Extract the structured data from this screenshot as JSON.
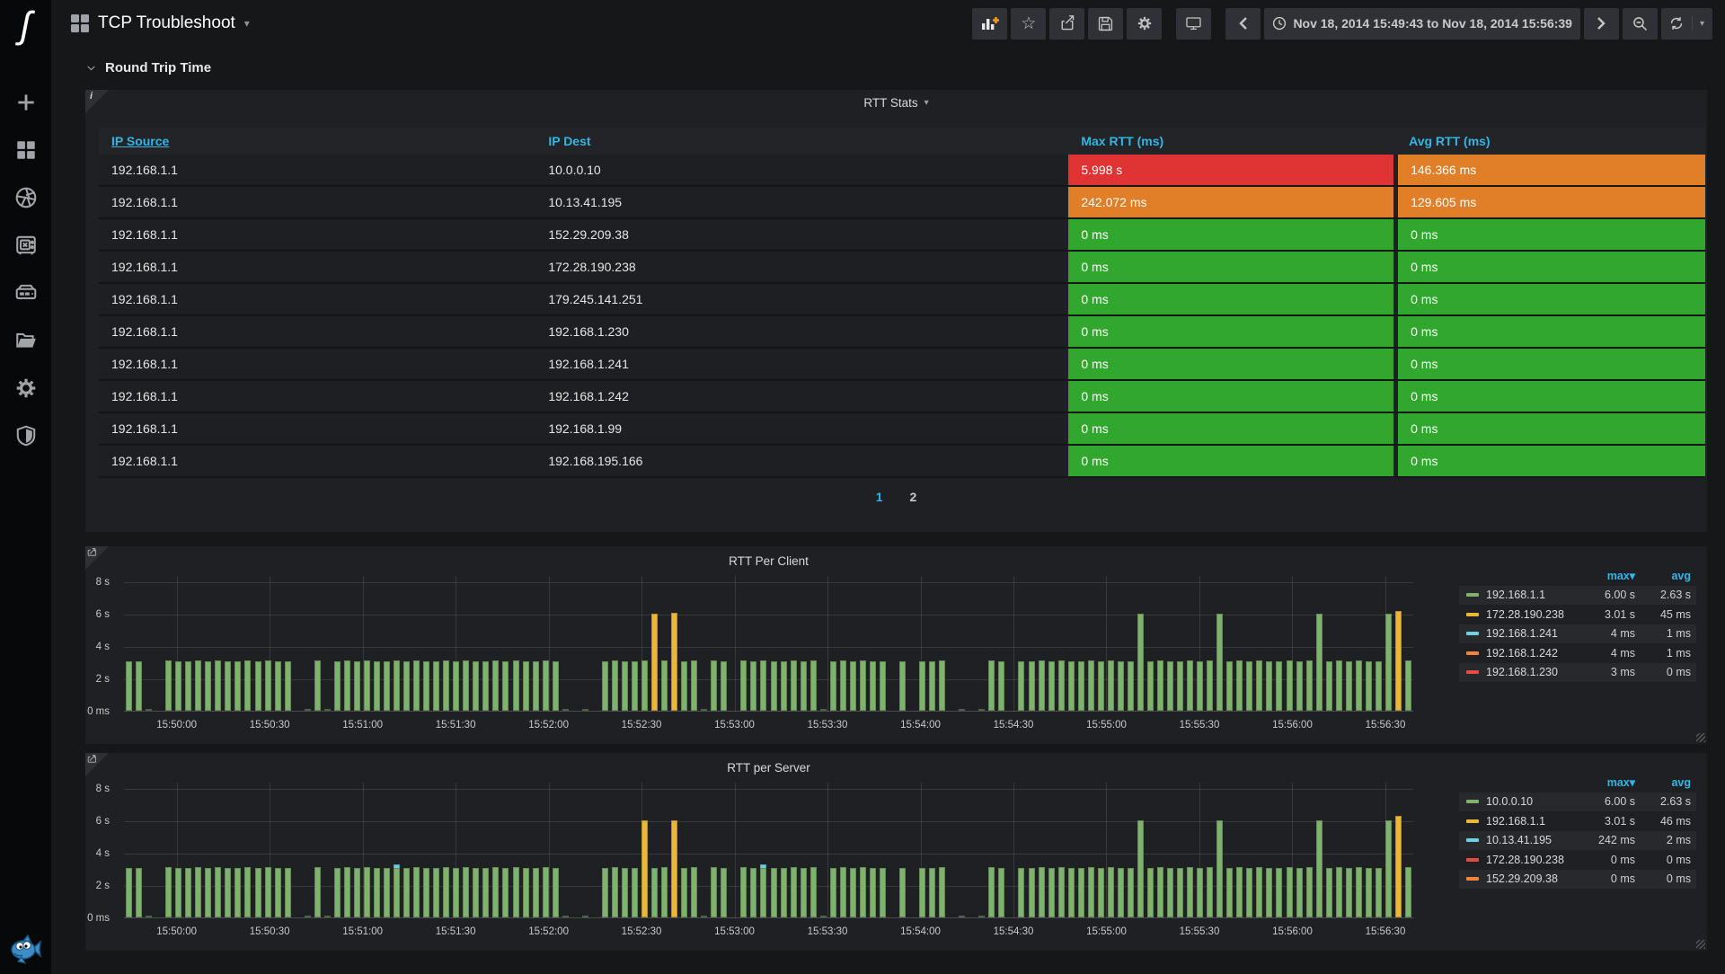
{
  "icons": {
    "caret_down": "▾",
    "star": "☆",
    "info": "i",
    "page_logo": "ʃ"
  },
  "sidebar": {
    "items": [
      {
        "name": "add",
        "icon": "plus-icon"
      },
      {
        "name": "dashboards",
        "icon": "grid-icon"
      },
      {
        "name": "snapshots",
        "icon": "aperture-icon"
      },
      {
        "name": "vault",
        "icon": "safe-icon"
      },
      {
        "name": "datasources",
        "icon": "drive-icon"
      },
      {
        "name": "folders",
        "icon": "folder-icon"
      },
      {
        "name": "settings",
        "icon": "gear-icon"
      },
      {
        "name": "security",
        "icon": "shield-icon"
      }
    ]
  },
  "nav": {
    "title": "TCP Troubleshoot",
    "time_range": "Nov 18, 2014 15:49:43 to Nov 18, 2014 15:56:39"
  },
  "row_header": {
    "title": "Round Trip Time"
  },
  "status_colors": {
    "red": "#e03434",
    "orange": "#e07f28",
    "green": "#31a82d"
  },
  "table_panel": {
    "title": "RTT Stats",
    "columns": [
      {
        "label": "IP Source",
        "sorted": true
      },
      {
        "label": "IP Dest",
        "sorted": false
      },
      {
        "label": "Max RTT (ms)",
        "sorted": false
      },
      {
        "label": "Avg RTT (ms)",
        "sorted": false
      }
    ],
    "rows": [
      {
        "source": "192.168.1.1",
        "dest": "10.0.0.10",
        "max": "5.998 s",
        "max_color": "red",
        "avg": "146.366 ms",
        "avg_color": "orange"
      },
      {
        "source": "192.168.1.1",
        "dest": "10.13.41.195",
        "max": "242.072 ms",
        "max_color": "orange",
        "avg": "129.605 ms",
        "avg_color": "orange"
      },
      {
        "source": "192.168.1.1",
        "dest": "152.29.209.38",
        "max": "0 ms",
        "max_color": "green",
        "avg": "0 ms",
        "avg_color": "green"
      },
      {
        "source": "192.168.1.1",
        "dest": "172.28.190.238",
        "max": "0 ms",
        "max_color": "green",
        "avg": "0 ms",
        "avg_color": "green"
      },
      {
        "source": "192.168.1.1",
        "dest": "179.245.141.251",
        "max": "0 ms",
        "max_color": "green",
        "avg": "0 ms",
        "avg_color": "green"
      },
      {
        "source": "192.168.1.1",
        "dest": "192.168.1.230",
        "max": "0 ms",
        "max_color": "green",
        "avg": "0 ms",
        "avg_color": "green"
      },
      {
        "source": "192.168.1.1",
        "dest": "192.168.1.241",
        "max": "0 ms",
        "max_color": "green",
        "avg": "0 ms",
        "avg_color": "green"
      },
      {
        "source": "192.168.1.1",
        "dest": "192.168.1.242",
        "max": "0 ms",
        "max_color": "green",
        "avg": "0 ms",
        "avg_color": "green"
      },
      {
        "source": "192.168.1.1",
        "dest": "192.168.1.99",
        "max": "0 ms",
        "max_color": "green",
        "avg": "0 ms",
        "avg_color": "green"
      },
      {
        "source": "192.168.1.1",
        "dest": "192.168.195.166",
        "max": "0 ms",
        "max_color": "green",
        "avg": "0 ms",
        "avg_color": "green"
      }
    ],
    "pages": [
      "1",
      "2"
    ],
    "active_page": "1"
  },
  "chart_data": [
    {
      "type": "bar",
      "title": "RTT Per Client",
      "time_start": "15:49:43",
      "time_end": "15:56:39",
      "y_ticks": [
        {
          "label": "8 s",
          "v": 8
        },
        {
          "label": "6 s",
          "v": 6
        },
        {
          "label": "4 s",
          "v": 4
        },
        {
          "label": "2 s",
          "v": 2
        },
        {
          "label": "0 ms",
          "v": 0
        }
      ],
      "x_ticks": [
        "15:50:00",
        "15:50:30",
        "15:51:00",
        "15:51:30",
        "15:52:00",
        "15:52:30",
        "15:53:00",
        "15:53:30",
        "15:54:00",
        "15:54:30",
        "15:55:00",
        "15:55:30",
        "15:56:00",
        "15:56:30"
      ],
      "ymax_s": 8.4,
      "base_value_s": 3.05,
      "bar_period_s": 3.2,
      "bar_color": "#7EB26D",
      "gaps": [
        [
          5,
          12
        ],
        [
          53,
          60
        ],
        [
          63,
          66
        ],
        [
          140,
          152
        ],
        [
          185,
          190
        ],
        [
          194,
          197
        ],
        [
          223,
          226
        ],
        [
          246,
          249
        ],
        [
          254,
          257
        ],
        [
          266,
          278
        ],
        [
          286,
          289
        ]
      ],
      "spikes": [
        {
          "t": 170,
          "v": 6.0,
          "c": "#EAB839"
        },
        {
          "t": 178,
          "v": 6.05,
          "c": "#EAB839"
        },
        {
          "t": 327,
          "v": 6.0,
          "c": "#7EB26D"
        },
        {
          "t": 355,
          "v": 6.0,
          "c": "#7EB26D"
        },
        {
          "t": 385,
          "v": 6.0,
          "c": "#7EB26D"
        },
        {
          "t": 408,
          "v": 6.0,
          "c": "#7EB26D"
        },
        {
          "t": 411,
          "v": 6.2,
          "c": "#EAB839"
        }
      ],
      "legend": {
        "headers": [
          "max",
          "avg"
        ],
        "sorted_header": "max",
        "series": [
          {
            "name": "192.168.1.1",
            "color": "#7EB26D",
            "max": "6.00 s",
            "avg": "2.63 s"
          },
          {
            "name": "172.28.190.238",
            "color": "#EAB839",
            "max": "3.01 s",
            "avg": "45 ms"
          },
          {
            "name": "192.168.1.241",
            "color": "#6ED0E0",
            "max": "4 ms",
            "avg": "1 ms"
          },
          {
            "name": "192.168.1.242",
            "color": "#EF843C",
            "max": "4 ms",
            "avg": "1 ms"
          },
          {
            "name": "192.168.1.230",
            "color": "#E24D42",
            "max": "3 ms",
            "avg": "0 ms"
          }
        ]
      }
    },
    {
      "type": "bar",
      "title": "RTT per Server",
      "time_start": "15:49:43",
      "time_end": "15:56:39",
      "y_ticks": [
        {
          "label": "8 s",
          "v": 8
        },
        {
          "label": "6 s",
          "v": 6
        },
        {
          "label": "4 s",
          "v": 4
        },
        {
          "label": "2 s",
          "v": 2
        },
        {
          "label": "0 ms",
          "v": 0
        }
      ],
      "x_ticks": [
        "15:50:00",
        "15:50:30",
        "15:51:00",
        "15:51:30",
        "15:52:00",
        "15:52:30",
        "15:53:00",
        "15:53:30",
        "15:54:00",
        "15:54:30",
        "15:55:00",
        "15:55:30",
        "15:56:00",
        "15:56:30"
      ],
      "ymax_s": 8.4,
      "base_value_s": 3.05,
      "bar_period_s": 3.2,
      "bar_color": "#7EB26D",
      "gaps": [
        [
          5,
          12
        ],
        [
          53,
          60
        ],
        [
          63,
          66
        ],
        [
          140,
          152
        ],
        [
          185,
          190
        ],
        [
          194,
          197
        ],
        [
          223,
          226
        ],
        [
          246,
          249
        ],
        [
          254,
          257
        ],
        [
          266,
          278
        ],
        [
          286,
          289
        ]
      ],
      "spikes": [
        {
          "t": 87,
          "v": 3.3,
          "c": "#6ED0E0",
          "overlay": true
        },
        {
          "t": 169,
          "v": 6.0,
          "c": "#EAB839"
        },
        {
          "t": 177,
          "v": 6.0,
          "c": "#EAB839"
        },
        {
          "t": 205,
          "v": 3.3,
          "c": "#6ED0E0",
          "overlay": true
        },
        {
          "t": 327,
          "v": 6.0,
          "c": "#7EB26D"
        },
        {
          "t": 355,
          "v": 6.0,
          "c": "#7EB26D"
        },
        {
          "t": 385,
          "v": 6.0,
          "c": "#7EB26D"
        },
        {
          "t": 408,
          "v": 6.0,
          "c": "#7EB26D"
        },
        {
          "t": 411,
          "v": 6.3,
          "c": "#EAB839"
        }
      ],
      "legend": {
        "headers": [
          "max",
          "avg"
        ],
        "sorted_header": "max",
        "series": [
          {
            "name": "10.0.0.10",
            "color": "#7EB26D",
            "max": "6.00 s",
            "avg": "2.63 s"
          },
          {
            "name": "192.168.1.1",
            "color": "#EAB839",
            "max": "3.01 s",
            "avg": "46 ms"
          },
          {
            "name": "10.13.41.195",
            "color": "#6ED0E0",
            "max": "242 ms",
            "avg": "2 ms"
          },
          {
            "name": "172.28.190.238",
            "color": "#E24D42",
            "max": "0 ms",
            "avg": "0 ms"
          },
          {
            "name": "152.29.209.38",
            "color": "#EF843C",
            "max": "0 ms",
            "avg": "0 ms"
          }
        ]
      }
    }
  ]
}
